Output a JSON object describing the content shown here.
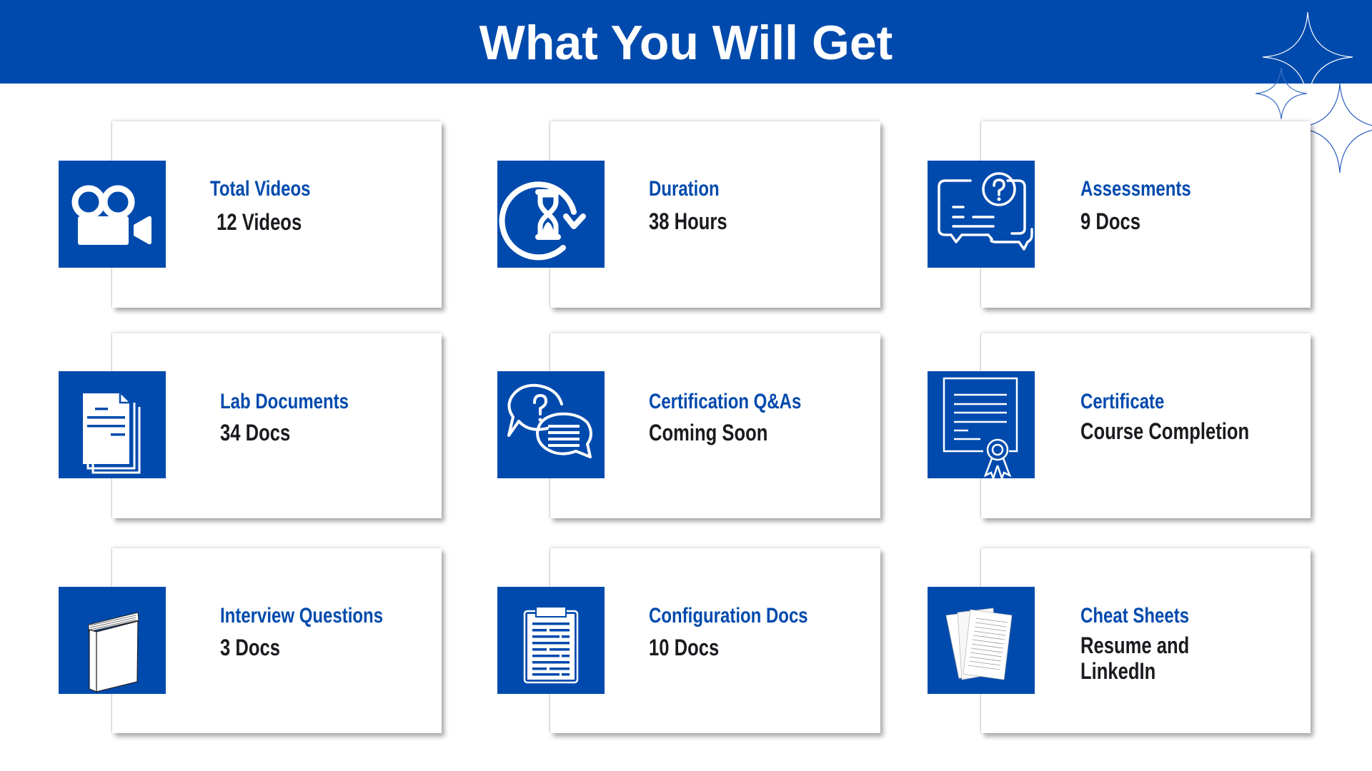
{
  "header": {
    "title": "What You Will Get",
    "decoration": "sparkle-stars"
  },
  "colors": {
    "brand_blue": "#004AAD",
    "value_text": "#1a1a1f",
    "background": "#ffffff"
  },
  "items": [
    {
      "icon": "video-camera-icon",
      "title": "Total Videos",
      "value": " 12 Videos"
    },
    {
      "icon": "hourglass-refresh-icon",
      "title": "Duration",
      "value": "38 Hours"
    },
    {
      "icon": "question-chat-icon",
      "title": "Assessments",
      "value": "9 Docs"
    },
    {
      "icon": "documents-stack-icon",
      "title": "Lab Documents",
      "value": "34 Docs"
    },
    {
      "icon": "qa-chat-bubbles-icon",
      "title": "Certification Q&As",
      "value": "Coming Soon"
    },
    {
      "icon": "certificate-icon",
      "title": "Certificate",
      "value": "Course Completion"
    },
    {
      "icon": "book-icon",
      "title": "Interview Questions",
      "value": "3 Docs"
    },
    {
      "icon": "clipboard-icon",
      "title": "Configuration Docs",
      "value": "10 Docs"
    },
    {
      "icon": "papers-icon",
      "title": "Cheat Sheets",
      "value": "Resume and\nLinkedIn"
    }
  ]
}
